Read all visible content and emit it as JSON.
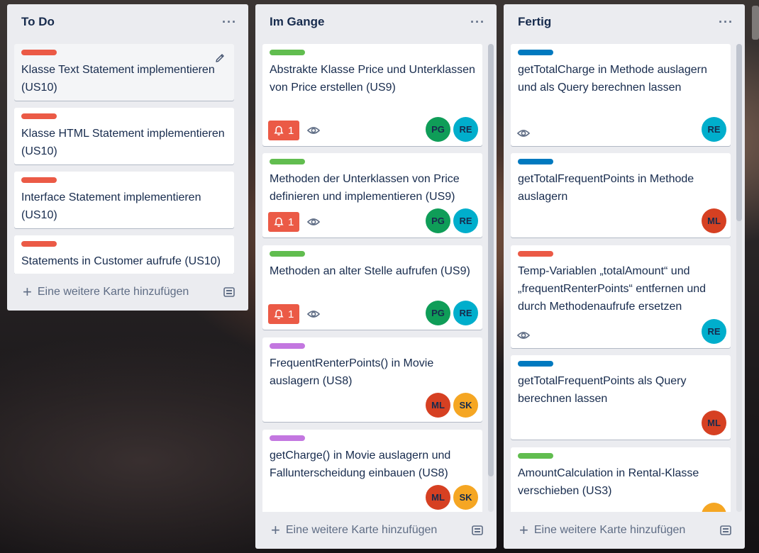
{
  "colors": {
    "red": "#eb5a46",
    "green": "#61bd4f",
    "blue": "#0079bf",
    "purple": "#c377e0",
    "avatar_PG": "#0f9d58",
    "avatar_RE": "#00aecc",
    "avatar_ML": "#d64022",
    "avatar_SK": "#f5a623"
  },
  "lists": [
    {
      "title": "To Do",
      "menu": "···",
      "add_card": "Eine weitere Karte hinzufügen",
      "cards": [
        {
          "label_color": "red",
          "title": "Klasse Text Statement implementieren (US10)"
        },
        {
          "label_color": "red",
          "title": "Klasse HTML Statement implementieren (US10)"
        },
        {
          "label_color": "red",
          "title": "Interface Statement implementieren (US10)"
        },
        {
          "label_color": "red",
          "title": "Statements in Customer aufrufe (US10)"
        }
      ]
    },
    {
      "title": "Im Gange",
      "menu": "···",
      "add_card": "Eine weitere Karte hinzufügen",
      "cards": [
        {
          "label_color": "green",
          "title": "Abstrakte Klasse Price und Unterklassen von Price erstellen (US9)",
          "notification_count": "1",
          "members": [
            "PG",
            "RE"
          ]
        },
        {
          "label_color": "green",
          "title": "Methoden der Unterklassen von Price definieren und implementieren (US9)",
          "notification_count": "1",
          "members": [
            "PG",
            "RE"
          ]
        },
        {
          "label_color": "green",
          "title": "Methoden an alter Stelle aufrufen (US9)",
          "notification_count": "1",
          "members": [
            "PG",
            "RE"
          ]
        },
        {
          "label_color": "purple",
          "title": "FrequentRenterPoints() in Movie auslagern (US8)",
          "members": [
            "ML",
            "SK"
          ]
        },
        {
          "label_color": "purple",
          "title": "getCharge() in Movie auslagern und Fallunterscheidung einbauen (US8)",
          "members": [
            "ML",
            "SK"
          ]
        }
      ]
    },
    {
      "title": "Fertig",
      "menu": "···",
      "add_card": "Eine weitere Karte hinzufügen",
      "cards": [
        {
          "label_color": "blue",
          "title": "getTotalCharge in Methode auslagern und als Query berechnen lassen",
          "members": [
            "RE"
          ]
        },
        {
          "label_color": "blue",
          "title": "getTotalFrequentPoints in Methode auslagern",
          "members": [
            "ML"
          ]
        },
        {
          "label_color": "red",
          "title": "Temp-Variablen „totalAmount“ und „frequentRenterPoints“ entfernen und durch Methodenaufrufe ersetzen",
          "members": [
            "RE"
          ]
        },
        {
          "label_color": "blue",
          "title": "getTotalFrequentPoints als Query berechnen lassen",
          "members": [
            "ML"
          ]
        },
        {
          "label_color": "green",
          "title": "AmountCalculation in Rental-Klasse verschieben (US3)",
          "members": [
            "SK"
          ]
        }
      ]
    }
  ]
}
